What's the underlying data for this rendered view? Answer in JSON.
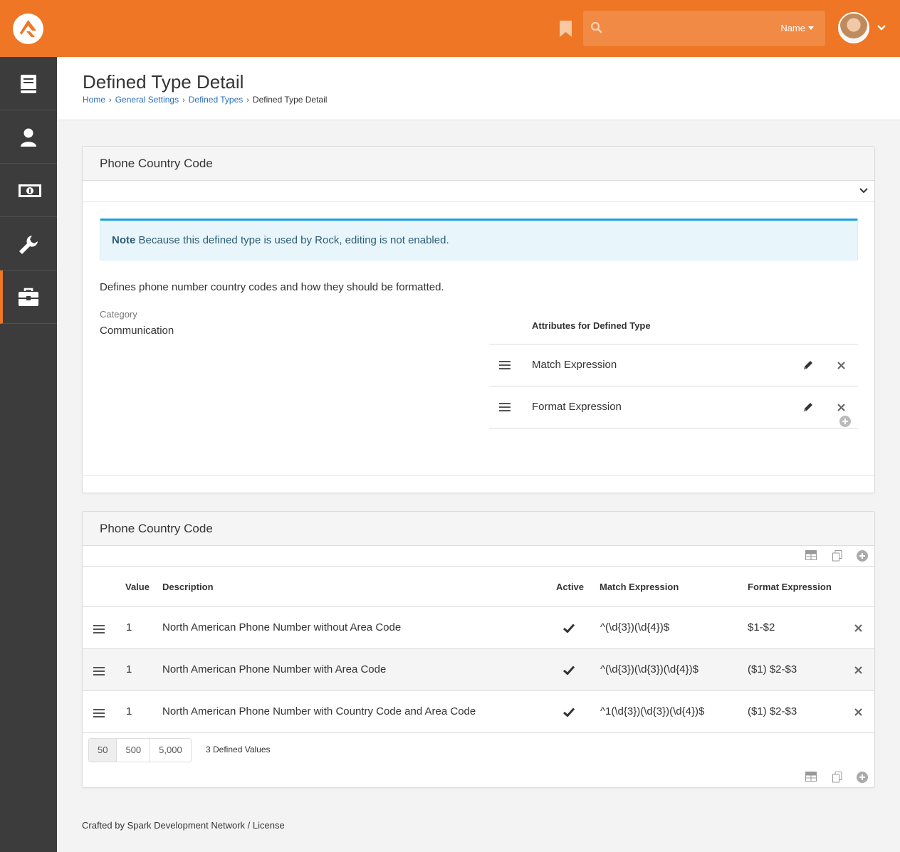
{
  "header": {
    "search_placeholder": "",
    "search_filter": "Name",
    "brand_color": "#ee7624"
  },
  "sidebar": {
    "items": [
      {
        "icon": "book-icon"
      },
      {
        "icon": "user-icon"
      },
      {
        "icon": "money-icon"
      },
      {
        "icon": "wrench-icon"
      },
      {
        "icon": "briefcase-icon",
        "active": true
      }
    ]
  },
  "page": {
    "title": "Defined Type Detail",
    "breadcrumb": [
      "Home",
      "General Settings",
      "Defined Types",
      "Defined Type Detail"
    ]
  },
  "detail_panel": {
    "title": "Phone Country Code",
    "alert_strong": "Note",
    "alert_text": " Because this defined type is used by Rock, editing is not enabled.",
    "description": "Defines phone number country codes and how they should be formatted.",
    "category_label": "Category",
    "category_value": "Communication",
    "attributes_heading": "Attributes for Defined Type",
    "attributes": [
      "Match Expression",
      "Format Expression"
    ]
  },
  "values_panel": {
    "title": "Phone Country Code",
    "columns": [
      "Value",
      "Description",
      "Active",
      "Match Expression",
      "Format Expression"
    ],
    "rows": [
      {
        "value": "1",
        "description": "North American Phone Number without Area Code",
        "active": true,
        "match": "^(\\d{3})(\\d{4})$",
        "format": "$1-$2"
      },
      {
        "value": "1",
        "description": "North American Phone Number with Area Code",
        "active": true,
        "match": "^(\\d{3})(\\d{3})(\\d{4})$",
        "format": "($1) $2-$3"
      },
      {
        "value": "1",
        "description": "North American Phone Number with Country Code and Area Code",
        "active": true,
        "match": "^1(\\d{3})(\\d{3})(\\d{4})$",
        "format": "($1) $2-$3"
      }
    ],
    "page_sizes": [
      "50",
      "500",
      "5,000"
    ],
    "count_text": "3 Defined Values"
  },
  "footer": {
    "text": "Crafted by Spark Development Network / License"
  }
}
